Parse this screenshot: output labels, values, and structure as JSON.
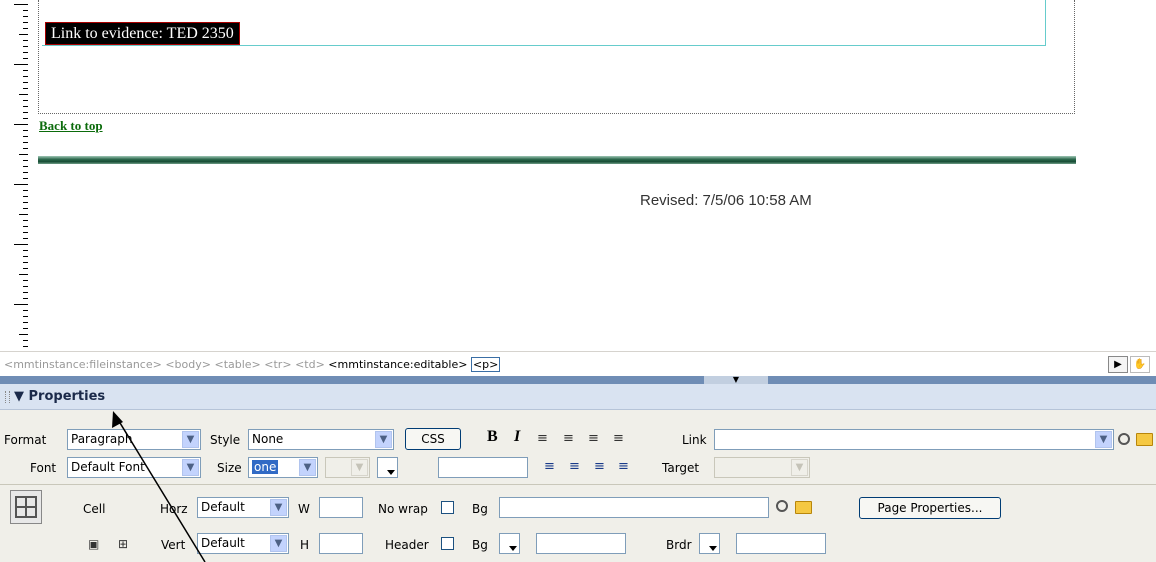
{
  "design": {
    "evidence_link": "Link to evidence: TED 2350",
    "back_to_top": "Back to top",
    "revised": "Revised: 7/5/06 10:58 AM"
  },
  "tag_selector": {
    "tags": [
      "<mmtinstance:fileinstance>",
      "<body>",
      "<table>",
      "<tr>",
      "<td>"
    ],
    "active_tag": "<mmtinstance:editable>",
    "selected_tag": "<p>"
  },
  "properties": {
    "title": "Properties",
    "format_label": "Format",
    "format_value": "Paragraph",
    "style_label": "Style",
    "style_value": "None",
    "css_button": "CSS",
    "bold": "B",
    "italic": "I",
    "link_label": "Link",
    "link_value": "",
    "font_label": "Font",
    "font_value": "Default Font",
    "size_label": "Size",
    "size_value": "one",
    "target_label": "Target",
    "cell_label": "Cell",
    "horz_label": "Horz",
    "horz_value": "Default",
    "w_label": "W",
    "nowrap_label": "No wrap",
    "bg_label": "Bg",
    "page_properties_button": "Page Properties...",
    "vert_label": "Vert",
    "vert_value": "Default",
    "h_label": "H",
    "header_label": "Header",
    "bg2_label": "Bg",
    "brdr_label": "Brdr"
  },
  "icons": {
    "collapse": "▼",
    "align": [
      "align-left-icon",
      "align-center-icon",
      "align-right-icon",
      "align-justify-icon"
    ],
    "lists": [
      "unordered-list-icon",
      "ordered-list-icon",
      "outdent-icon",
      "indent-icon"
    ]
  },
  "colors": {
    "evidence_bg": "#000000",
    "back_to_top": "#0b6b0b",
    "panel_header": "#d9e3f1",
    "panel_body": "#f0efe9"
  }
}
